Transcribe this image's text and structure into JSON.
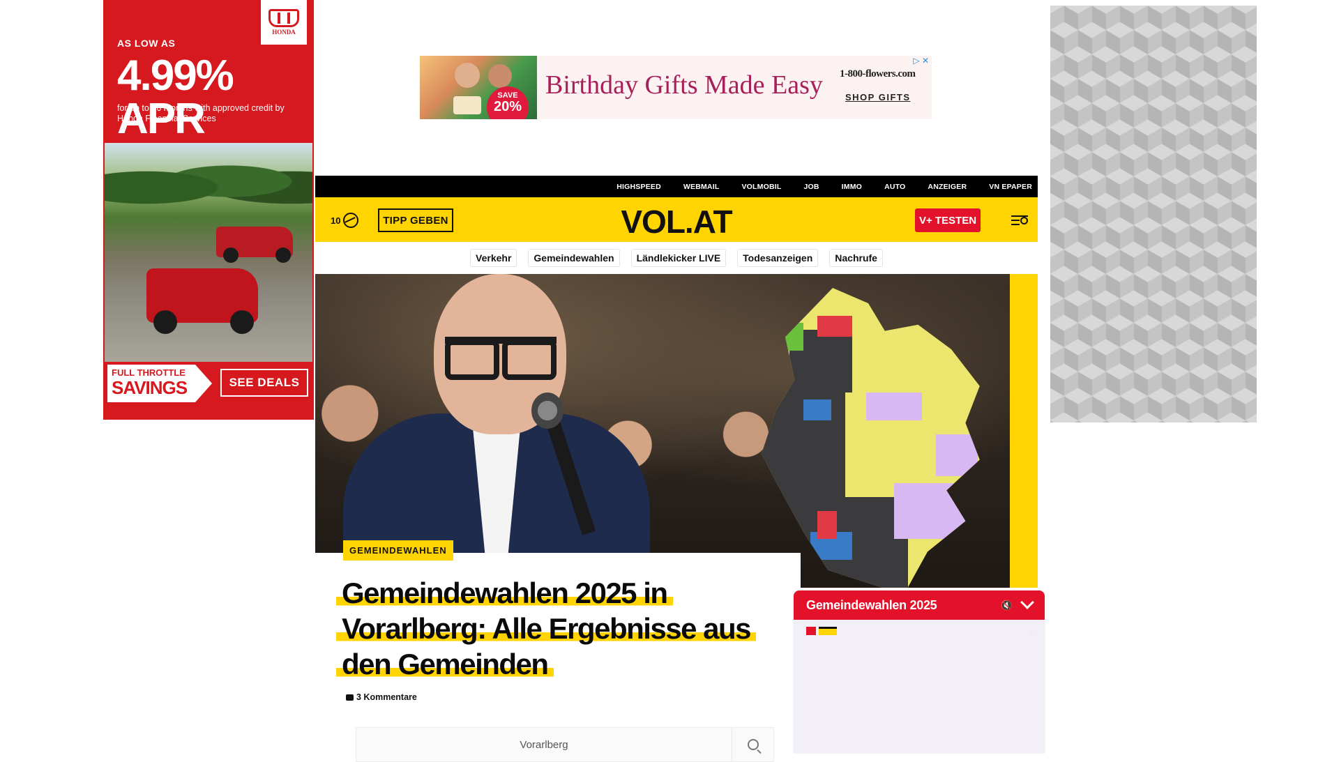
{
  "ads": {
    "left": {
      "brand": "HONDA",
      "as_low_as": "AS LOW AS",
      "rate": "4.99% APR",
      "rate_sub": "for up to 36 months with approved credit by Honda Financial Services",
      "promo_line1": "FULL THROTTLE",
      "promo_line2": "SAVINGS",
      "cta": "SEE DEALS"
    },
    "top": {
      "badge_top": "SAVE",
      "badge_value": "20%",
      "headline": "Birthday Gifts Made Easy",
      "logo": "1-800-flowers.com",
      "cta": "SHOP GIFTS"
    }
  },
  "topnav": [
    "HIGHSPEED",
    "WEBMAIL",
    "VOLMOBIL",
    "JOB",
    "IMMO",
    "AUTO",
    "ANZEIGER",
    "VN EPAPER"
  ],
  "header": {
    "temperature": "10",
    "tipp_button": "TIPP GEBEN",
    "logo": "VOL.AT",
    "vplus_button": "V+ TESTEN"
  },
  "tags": [
    "Verkehr",
    "Gemeindewahlen",
    "Ländlekicker LIVE",
    "Todesanzeigen",
    "Nachrufe"
  ],
  "article": {
    "category": "GEMEINDEWAHLEN",
    "headline": "Gemeindewahlen 2025 in Vorarlberg: Alle Ergebnisse aus den Gemeinden",
    "comments": "3 Kommentare",
    "search_value": "Vorarlberg"
  },
  "video": {
    "title": "Gemeindewahlen 2025"
  },
  "colors": {
    "brand_yellow": "#ffd400",
    "accent_red": "#e4112a",
    "black": "#000000"
  }
}
